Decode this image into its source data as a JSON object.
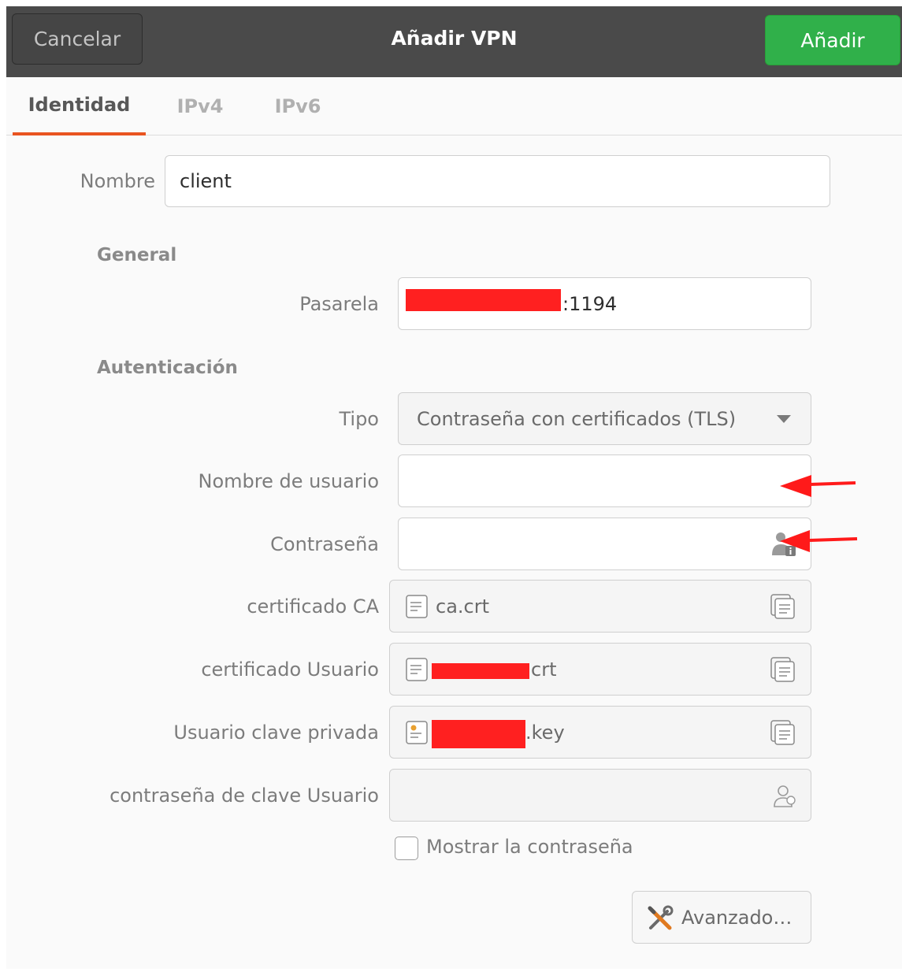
{
  "header": {
    "cancel_label": "Cancelar",
    "title": "Añadir VPN",
    "add_label": "Añadir"
  },
  "tabs": [
    {
      "label": "Identidad",
      "active": true
    },
    {
      "label": "IPv4",
      "active": false
    },
    {
      "label": "IPv6",
      "active": false
    }
  ],
  "name_field": {
    "label": "Nombre",
    "value": "client"
  },
  "general": {
    "heading": "General",
    "gateway_label": "Pasarela",
    "gateway_value_suffix": ":1194"
  },
  "auth": {
    "heading": "Autenticación",
    "type_label": "Tipo",
    "type_value": "Contraseña con certificados (TLS)",
    "username_label": "Nombre de usuario",
    "username_value": "",
    "password_label": "Contraseña",
    "password_value": "",
    "ca_label": "certificado CA",
    "ca_file": "ca.crt",
    "user_cert_label": "certificado Usuario",
    "user_cert_suffix": "crt",
    "private_key_label": "Usuario clave privada",
    "private_key_suffix": ".key",
    "key_password_label": "contraseña de clave Usuario",
    "key_password_value": "",
    "show_password_label": "Mostrar la contraseña",
    "show_password_checked": false
  },
  "advanced": {
    "label": "Avanzado…"
  },
  "icons": {
    "dropdown": "pan-down-icon",
    "password_storage": "user-info-icon",
    "file": "text-file-icon",
    "key_file": "key-file-icon",
    "browse": "document-open-icon",
    "person": "person-icon",
    "tools": "tools-icon"
  },
  "colors": {
    "header_bg": "#4a4a4a",
    "add_button": "#30b04a",
    "tab_indicator": "#e95420",
    "redaction": "#ff2020",
    "annotation_arrow": "#ff1a1a"
  }
}
